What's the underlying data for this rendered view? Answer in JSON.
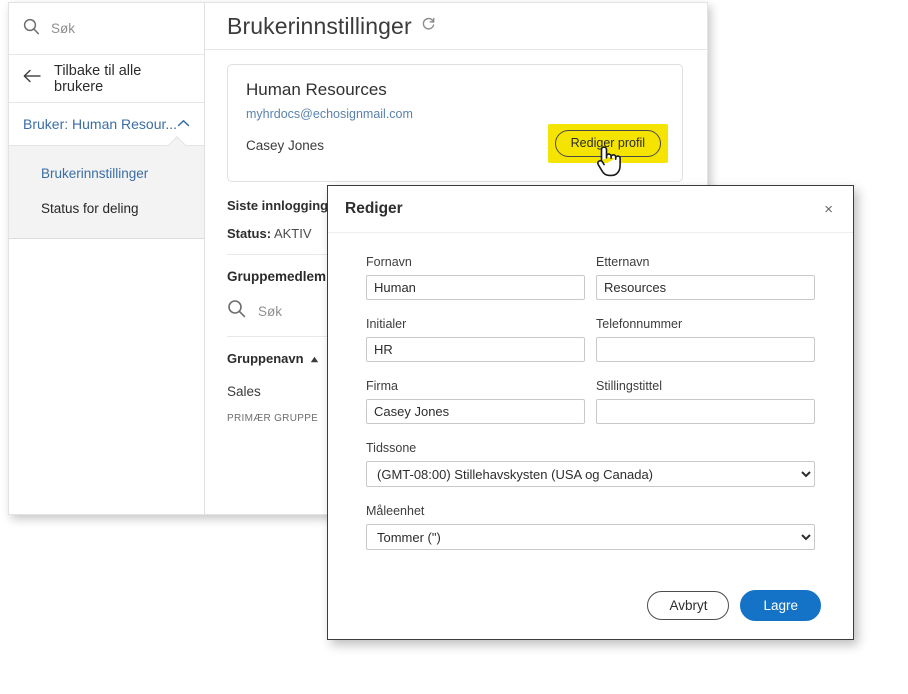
{
  "sidebar": {
    "search_placeholder": "Søk",
    "back_label": "Tilbake til alle brukere",
    "group_label": "Bruker: Human Resour...",
    "submenu": [
      {
        "label": "Brukerinnstillinger"
      },
      {
        "label": "Status for deling"
      }
    ]
  },
  "main": {
    "page_title": "Brukerinnstillinger",
    "user_card": {
      "name": "Human Resources",
      "email": "myhrdocs@echosignmail.com",
      "person": "Casey Jones",
      "edit_button": "Rediger profil"
    },
    "info": {
      "last_login_label": "Siste innlogging:",
      "status_label": "Status:",
      "status_value": "AKTIV"
    },
    "group_section": {
      "title": "Gruppemedlem",
      "search_placeholder": "Søk",
      "column_header": "Gruppenavn",
      "rows": [
        {
          "name": "Sales",
          "sub": "PRIMÆR GRUPPE"
        }
      ]
    }
  },
  "modal": {
    "title": "Rediger",
    "close_label": "×",
    "fields": {
      "first_name_label": "Fornavn",
      "first_name_value": "Human",
      "last_name_label": "Etternavn",
      "last_name_value": "Resources",
      "initials_label": "Initialer",
      "initials_value": "HR",
      "phone_label": "Telefonnummer",
      "phone_value": "",
      "company_label": "Firma",
      "company_value": "Casey Jones",
      "title_label": "Stillingstittel",
      "title_value": "",
      "timezone_label": "Tidssone",
      "timezone_value": "(GMT-08:00) Stillehavskysten (USA og Canada)",
      "unit_label": "Måleenhet",
      "unit_value": "Tommer (\")"
    },
    "cancel_label": "Avbryt",
    "save_label": "Lagre"
  },
  "colors": {
    "accent_blue": "#1473c6",
    "link_blue": "#3a6ea5",
    "highlight_yellow": "#f5e400"
  }
}
